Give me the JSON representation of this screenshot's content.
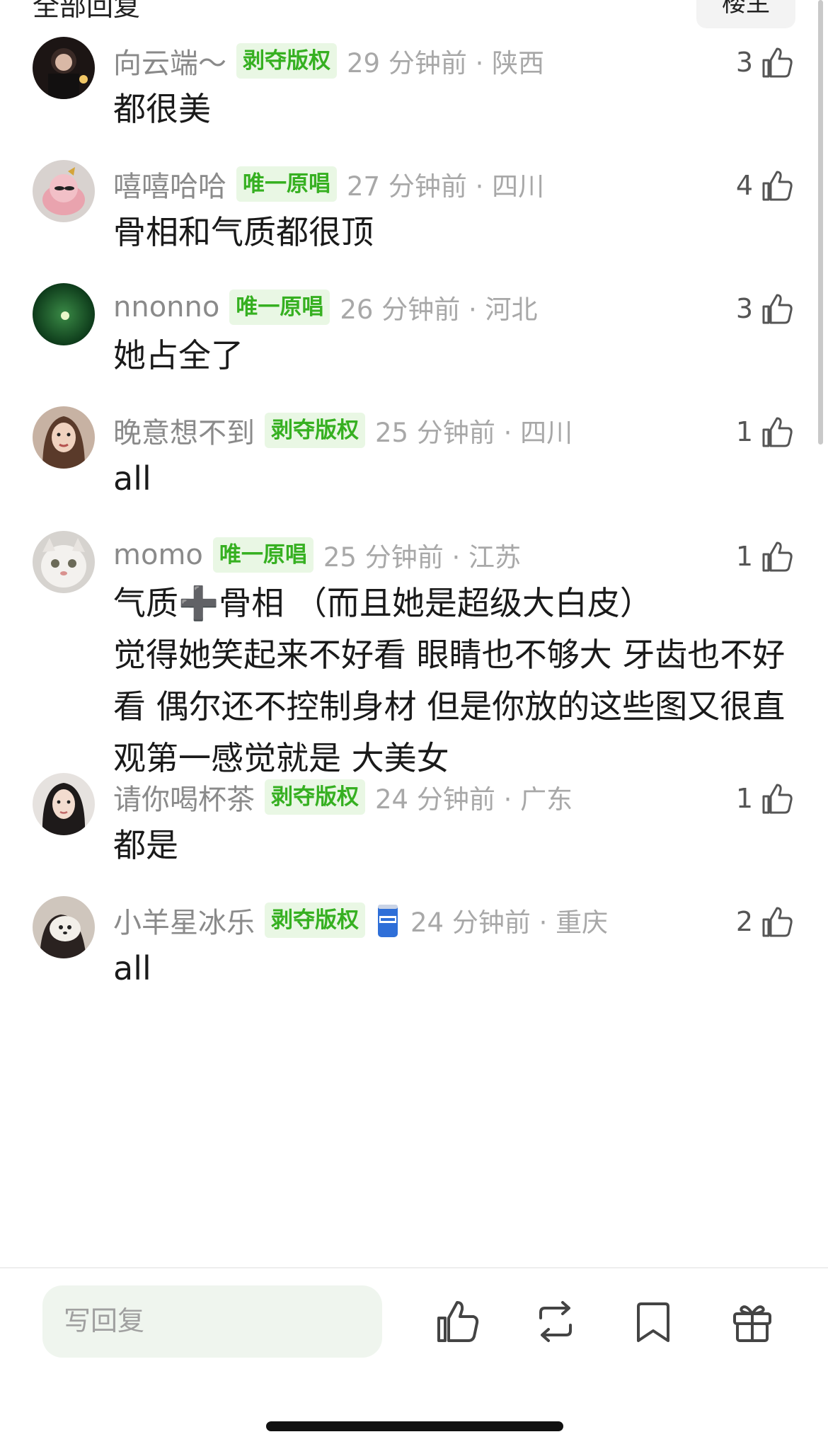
{
  "header": {
    "section_title": "全部回复",
    "op_label": "楼主"
  },
  "comments": [
    {
      "user": "向云端～",
      "badge": "剥夺版权",
      "time": "29 分钟前 · 陕西",
      "likes": "3",
      "content": "都很美",
      "avatar_icon": "avatar-photo-dark"
    },
    {
      "user": "嘻嘻哈哈",
      "badge": "唯一原唱",
      "time": "27 分钟前 · 四川",
      "likes": "4",
      "content": "骨相和气质都很顶",
      "avatar_icon": "avatar-cake"
    },
    {
      "user": "nnonno",
      "badge": "唯一原唱",
      "time": "26 分钟前 · 河北",
      "likes": "3",
      "content": "她占全了",
      "avatar_icon": "avatar-green-glow"
    },
    {
      "user": "晚意想不到",
      "badge": "剥夺版权",
      "time": "25 分钟前 · 四川",
      "likes": "1",
      "content": "all",
      "avatar_icon": "avatar-portrait"
    },
    {
      "user": "momo",
      "badge": "唯一原唱",
      "time": "25 分钟前 · 江苏",
      "likes": "1",
      "content": "气质➕骨相 （而且她是超级大白皮）\n觉得她笑起来不好看 眼睛也不够大 牙齿也不好看 偶尔还不控制身材 但是你放的这些图又很直观第一感觉就是 大美女",
      "avatar_icon": "avatar-cat"
    },
    {
      "user": "请你喝杯茶",
      "badge": "剥夺版权",
      "time": "24 分钟前 · 广东",
      "likes": "1",
      "content": "都是",
      "avatar_icon": "avatar-portrait-dark-hair"
    },
    {
      "user": "小羊星冰乐",
      "badge": "剥夺版权",
      "time": "24 分钟前 · 重庆",
      "likes": "2",
      "content": "all",
      "avatar_icon": "avatar-dog",
      "extra_icon": "drink-can-icon"
    }
  ],
  "bottom_bar": {
    "reply_placeholder": "写回复",
    "icons": [
      "thumbs-up-icon",
      "repost-icon",
      "bookmark-icon",
      "gift-icon"
    ]
  },
  "colors": {
    "badge_green": "#36b021",
    "badge_bg": "#e9f7e4",
    "meta_gray": "#8a8a8a",
    "input_bg": "#eff5ee"
  }
}
